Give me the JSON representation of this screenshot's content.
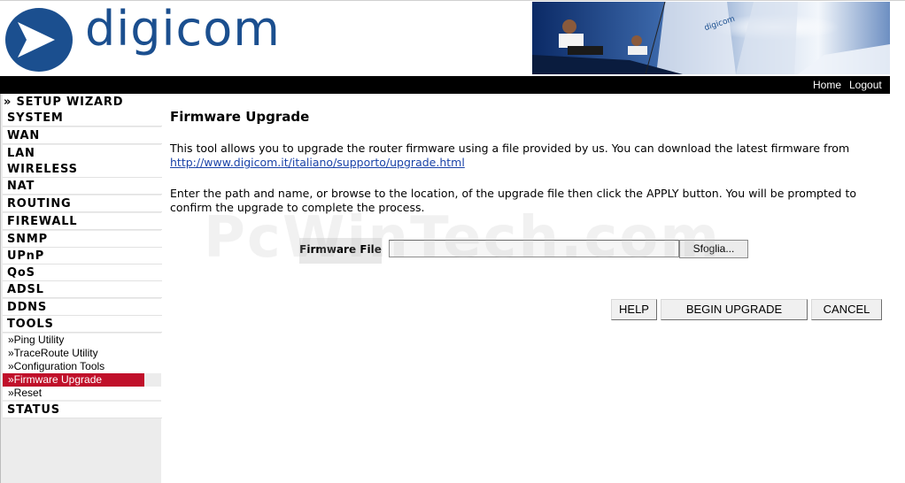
{
  "header": {
    "logo_text": "digicom",
    "banner_logo_text": "digicom"
  },
  "topbar": {
    "home_label": "Home",
    "logout_label": "Logout"
  },
  "sidebar": {
    "setup_wizard_label": "» SETUP WIZARD",
    "items": [
      {
        "label": "SYSTEM"
      },
      {
        "label": "WAN"
      },
      {
        "label": "LAN"
      },
      {
        "label": "WIRELESS"
      },
      {
        "label": "NAT"
      },
      {
        "label": "ROUTING"
      },
      {
        "label": "FIREWALL"
      },
      {
        "label": "SNMP"
      },
      {
        "label": "UPnP"
      },
      {
        "label": "QoS"
      },
      {
        "label": "ADSL"
      },
      {
        "label": "DDNS"
      },
      {
        "label": "TOOLS"
      }
    ],
    "tools_subitems": [
      {
        "label": "»Ping Utility"
      },
      {
        "label": "»TraceRoute Utility"
      },
      {
        "label": "»Configuration Tools"
      },
      {
        "label": "»Firmware Upgrade"
      },
      {
        "label": "»Reset"
      }
    ],
    "status_label": "STATUS",
    "active_color": "#c0102a"
  },
  "main": {
    "title": "Firmware Upgrade",
    "intro_text": "This tool allows you to upgrade the router firmware using a file provided by us. You can download the latest firmware from",
    "intro_link": "http://www.digicom.it/italiano/supporto/upgrade.html",
    "instructions": "Enter the path and name, or browse to the location, of the upgrade file then click the APPLY button. You will be prompted to confirm the upgrade to complete the process.",
    "firmware_file_label": "Firmware File",
    "firmware_file_value": "",
    "browse_label": "Sfoglia...",
    "help_label": "HELP",
    "begin_upgrade_label": "BEGIN UPGRADE",
    "cancel_label": "CANCEL"
  },
  "watermark": "PcWinTech.com",
  "colors": {
    "brand_blue": "#1b4f8f",
    "link_blue": "#1a43a8",
    "topbar_black": "#000000",
    "sidebar_bg": "#ececec"
  }
}
